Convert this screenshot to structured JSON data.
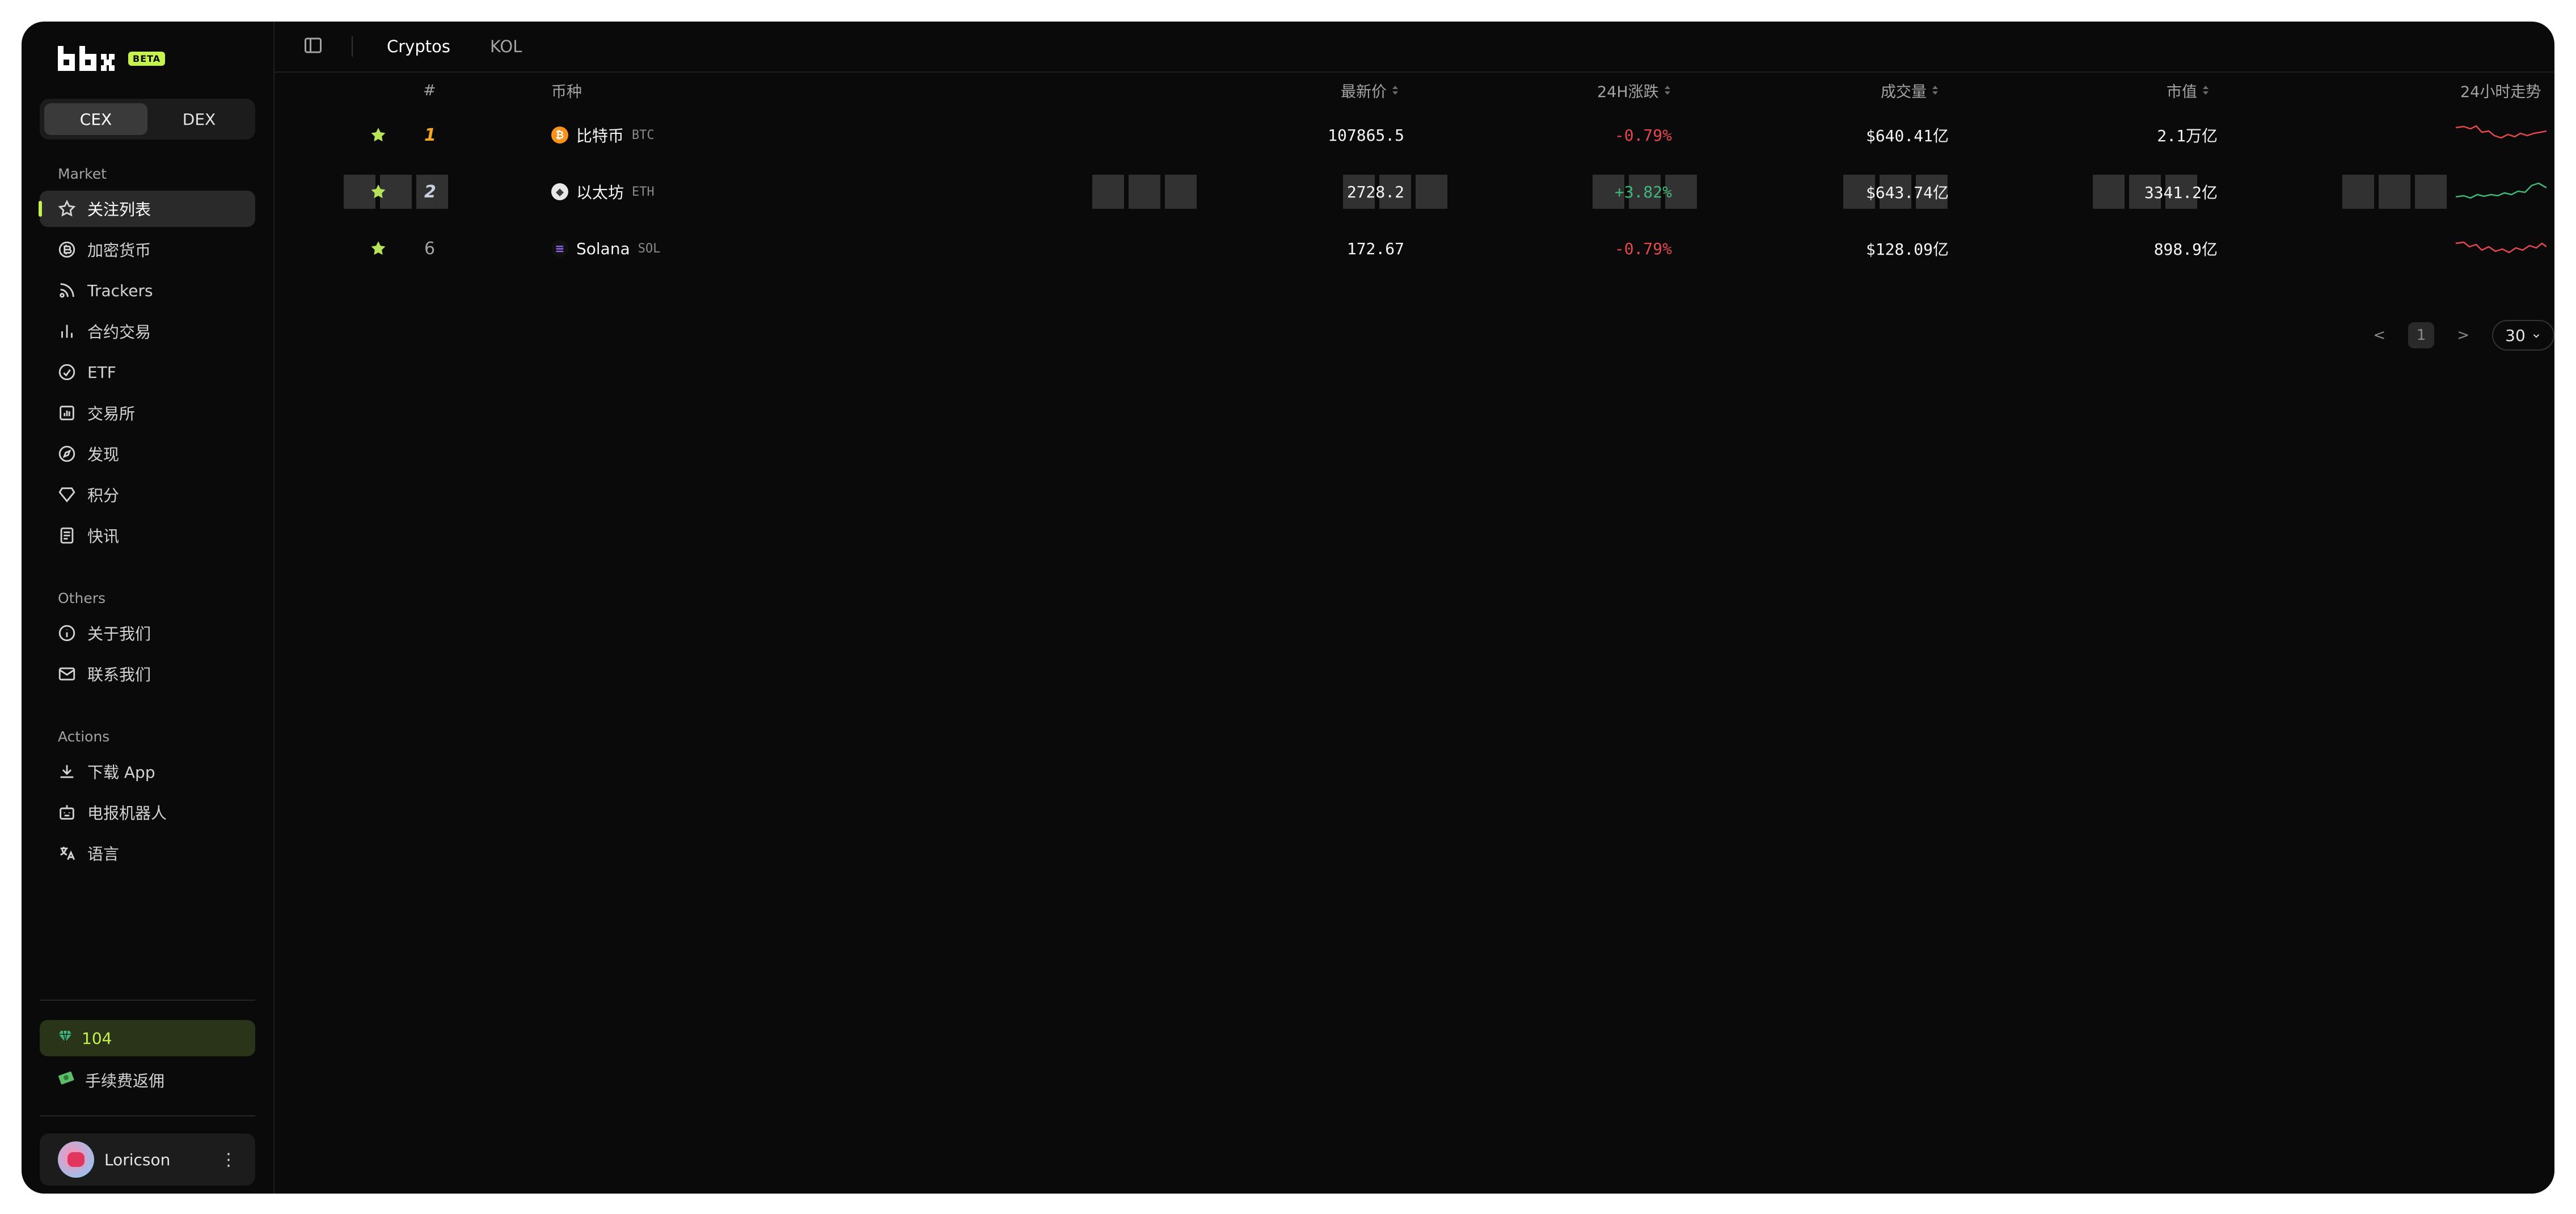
{
  "brand": {
    "beta_badge": "BETA"
  },
  "sidebar": {
    "segment": [
      "CEX",
      "DEX"
    ],
    "market_title": "Market",
    "market_items": [
      {
        "label": "关注列表",
        "icon": "star-icon"
      },
      {
        "label": "加密货币",
        "icon": "coin-icon"
      },
      {
        "label": "Trackers",
        "icon": "tracker-icon"
      },
      {
        "label": "合约交易",
        "icon": "bar-chart-icon"
      },
      {
        "label": "ETF",
        "icon": "check-circle-icon"
      },
      {
        "label": "交易所",
        "icon": "exchange-icon"
      },
      {
        "label": "发现",
        "icon": "compass-icon"
      },
      {
        "label": "积分",
        "icon": "diamond-icon"
      },
      {
        "label": "快讯",
        "icon": "news-icon"
      }
    ],
    "others_title": "Others",
    "others_items": [
      {
        "label": "关于我们",
        "icon": "info-icon"
      },
      {
        "label": "联系我们",
        "icon": "mail-icon"
      }
    ],
    "actions_title": "Actions",
    "actions_items": [
      {
        "label": "下载 App",
        "icon": "download-icon"
      },
      {
        "label": "电报机器人",
        "icon": "bot-icon"
      },
      {
        "label": "语言",
        "icon": "language-icon"
      }
    ],
    "points": "104",
    "rebate": "手续费返佣",
    "user": "Loricson"
  },
  "topbar": {
    "tabs": [
      "Cryptos",
      "KOL"
    ]
  },
  "table": {
    "headers": {
      "rank": "#",
      "coin": "币种",
      "price": "最新价",
      "change": "24H涨跌",
      "volume": "成交量",
      "mcap": "市值",
      "trend": "24小时走势"
    },
    "rows": [
      {
        "rank": "1",
        "name": "比特币",
        "ticker": "BTC",
        "price": "107865.5",
        "change": "-0.79%",
        "volume": "$640.41亿",
        "mcap": "2.1万亿",
        "trend": "down"
      },
      {
        "rank": "2",
        "name": "以太坊",
        "ticker": "ETH",
        "price": "2728.2",
        "change": "+3.82%",
        "volume": "$643.74亿",
        "mcap": "3341.2亿",
        "trend": "up"
      },
      {
        "rank": "6",
        "name": "Solana",
        "ticker": "SOL",
        "price": "172.67",
        "change": "-0.79%",
        "volume": "$128.09亿",
        "mcap": "898.9亿",
        "trend": "down"
      }
    ]
  },
  "pagination": {
    "prev": "<",
    "page": "1",
    "next": ">",
    "page_size": "30"
  },
  "colors": {
    "accent": "#c6f24e",
    "negative": "#e5484d",
    "positive": "#3fb87a",
    "background": "#0a0a0a"
  }
}
